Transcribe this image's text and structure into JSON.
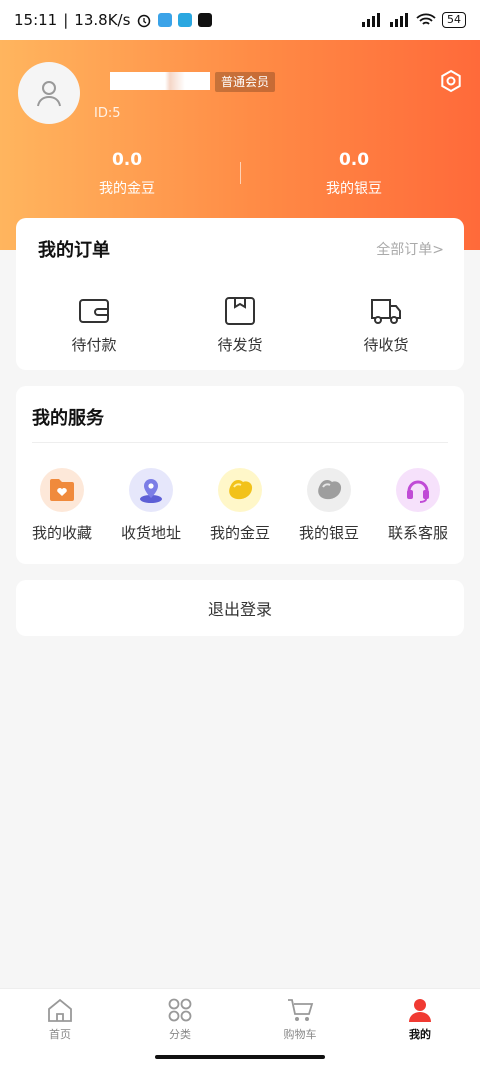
{
  "status_bar": {
    "time": "15:11",
    "net_speed": "13.8K/s",
    "battery": "54"
  },
  "header": {
    "member_level": "普通会员",
    "user_id": "ID:5",
    "gold_value": "0.0",
    "gold_label": "我的金豆",
    "silver_value": "0.0",
    "silver_label": "我的银豆",
    "gradient_start": "#ffb55e",
    "gradient_end": "#ff6a3a"
  },
  "orders": {
    "title": "我的订单",
    "all_label": "全部订单>",
    "items": [
      {
        "label": "待付款",
        "icon": "wallet-icon"
      },
      {
        "label": "待发货",
        "icon": "box-icon"
      },
      {
        "label": "待收货",
        "icon": "truck-icon"
      }
    ]
  },
  "services": {
    "title": "我的服务",
    "items": [
      {
        "label": "我的收藏",
        "icon": "favorite-folder-icon",
        "color": "#f08a3c"
      },
      {
        "label": "收货地址",
        "icon": "location-pin-icon",
        "color": "#5d5fd6"
      },
      {
        "label": "我的金豆",
        "icon": "gold-bean-icon",
        "color": "#f2c21a"
      },
      {
        "label": "我的银豆",
        "icon": "silver-bean-icon",
        "color": "#9e9e9e"
      },
      {
        "label": "联系客服",
        "icon": "headset-icon",
        "color": "#c04bd6"
      }
    ]
  },
  "logout": {
    "label": "退出登录"
  },
  "tabbar": {
    "items": [
      {
        "label": "首页",
        "icon": "home-icon"
      },
      {
        "label": "分类",
        "icon": "category-icon"
      },
      {
        "label": "购物车",
        "icon": "cart-icon"
      },
      {
        "label": "我的",
        "icon": "profile-icon",
        "active": true
      }
    ],
    "active_color": "#f03a32"
  }
}
